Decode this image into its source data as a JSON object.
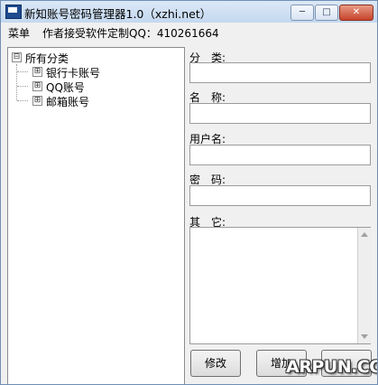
{
  "window": {
    "title": "新知账号密码管理器1.0（xzhi.net）"
  },
  "title_buttons": {
    "minimize": "─",
    "maximize": "□",
    "close": "✕"
  },
  "menu": {
    "main": "菜单",
    "author_note": "作者接受软件定制QQ：410261664"
  },
  "tree": {
    "root": {
      "label": "所有分类",
      "expander": "⊟"
    },
    "children": [
      {
        "label": "银行卡账号",
        "expander": "⊞"
      },
      {
        "label": "QQ账号",
        "expander": "⊞"
      },
      {
        "label": "邮箱账号",
        "expander": "⊞"
      }
    ]
  },
  "form": {
    "category_label": "分　类:",
    "category_value": "",
    "name_label": "名　称:",
    "name_value": "",
    "username_label": "用户名:",
    "username_value": "",
    "password_label": "密　码:",
    "password_value": "",
    "other_label": "其　它:",
    "other_value": ""
  },
  "buttons": {
    "modify": "修改",
    "add": "增加",
    "delete": ""
  },
  "watermark": "ARPUN.COM",
  "colors": {
    "title_gradient_top": "#dbe8f7",
    "title_gradient_bottom": "#c4d8ef",
    "close_button": "#c7442b",
    "window_background": "#f0f0f0"
  }
}
